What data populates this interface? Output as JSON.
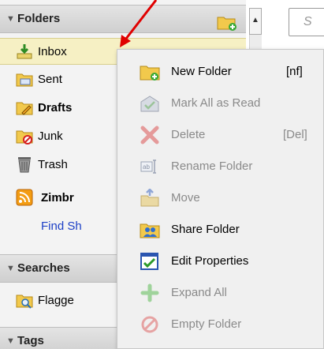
{
  "tree": {
    "folders_header": "Folders",
    "searches_header": "Searches",
    "tags_header": "Tags",
    "items": [
      {
        "label": "Inbox",
        "icon": "inbox-icon"
      },
      {
        "label": "Sent",
        "icon": "sent-icon"
      },
      {
        "label": "Drafts",
        "icon": "drafts-icon"
      },
      {
        "label": "Junk",
        "icon": "junk-icon"
      },
      {
        "label": "Trash",
        "icon": "trash-icon"
      },
      {
        "label": "Zimbr",
        "icon": "rss-icon"
      },
      {
        "label": "Find Sh",
        "icon": ""
      }
    ],
    "saved_search": {
      "label": "Flagge",
      "icon": "search-folder-icon"
    }
  },
  "search_placeholder": "S",
  "scroll_up_glyph": "▲",
  "menu": {
    "items": [
      {
        "label": "New Folder",
        "shortcut": "[nf]",
        "enabled": true,
        "icon": "new-folder-icon"
      },
      {
        "label": "Mark All as Read",
        "shortcut": "",
        "enabled": false,
        "icon": "mark-read-icon"
      },
      {
        "label": "Delete",
        "shortcut": "[Del]",
        "enabled": false,
        "icon": "delete-icon"
      },
      {
        "label": "Rename Folder",
        "shortcut": "",
        "enabled": false,
        "icon": "rename-icon"
      },
      {
        "label": "Move",
        "shortcut": "",
        "enabled": false,
        "icon": "move-icon"
      },
      {
        "label": "Share Folder",
        "shortcut": "",
        "enabled": true,
        "icon": "share-folder-icon"
      },
      {
        "label": "Edit Properties",
        "shortcut": "",
        "enabled": true,
        "icon": "edit-properties-icon"
      },
      {
        "label": "Expand All",
        "shortcut": "",
        "enabled": false,
        "icon": "expand-all-icon"
      },
      {
        "label": "Empty Folder",
        "shortcut": "",
        "enabled": false,
        "icon": "empty-folder-icon"
      }
    ]
  },
  "colors": {
    "selected_row": "#f6f0c4",
    "link": "#1c3fc6",
    "disabled_text": "#8a8a8a",
    "annotation_arrow": "#e00000"
  }
}
